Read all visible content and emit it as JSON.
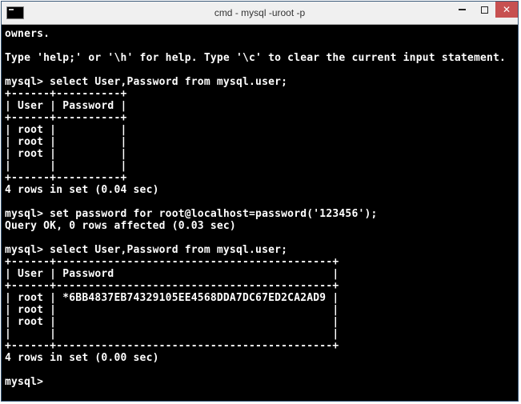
{
  "window": {
    "title": "cmd - mysql  -uroot -p"
  },
  "terminal": {
    "lines": [
      "owners.",
      "",
      "Type 'help;' or '\\h' for help. Type '\\c' to clear the current input statement.",
      "",
      "mysql> select User,Password from mysql.user;",
      "+------+----------+",
      "| User | Password |",
      "+------+----------+",
      "| root |          |",
      "| root |          |",
      "| root |          |",
      "|      |          |",
      "+------+----------+",
      "4 rows in set (0.04 sec)",
      "",
      "mysql> set password for root@localhost=password('123456');",
      "Query OK, 0 rows affected (0.03 sec)",
      "",
      "mysql> select User,Password from mysql.user;",
      "+------+-------------------------------------------+",
      "| User | Password                                  |",
      "+------+-------------------------------------------+",
      "| root | *6BB4837EB74329105EE4568DDA7DC67ED2CA2AD9 |",
      "| root |                                           |",
      "| root |                                           |",
      "|      |                                           |",
      "+------+-------------------------------------------+",
      "4 rows in set (0.00 sec)",
      "",
      "mysql>"
    ]
  }
}
